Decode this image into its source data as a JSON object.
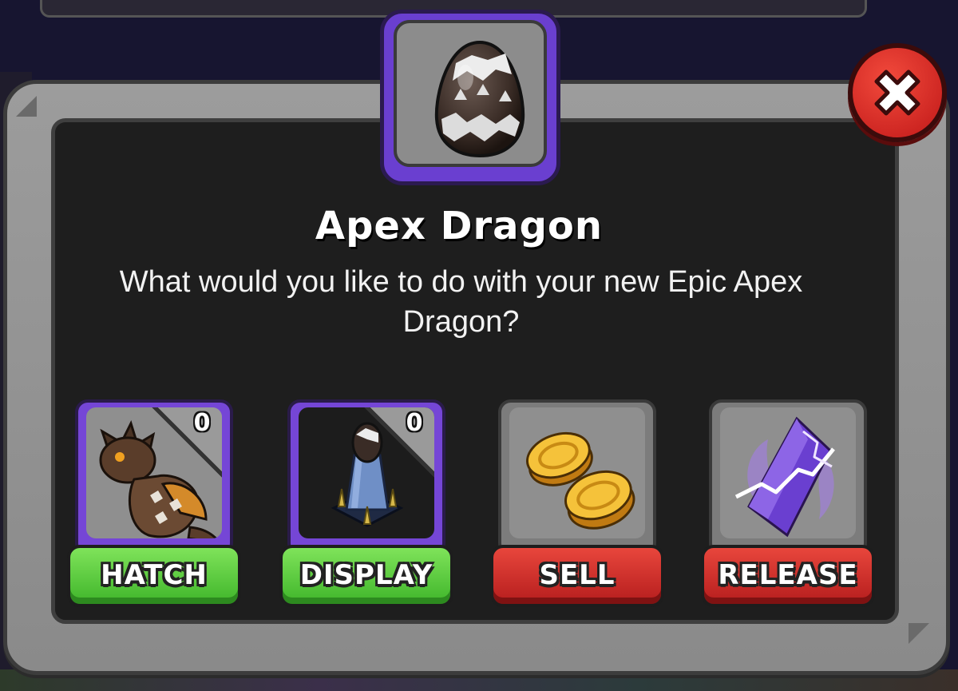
{
  "dialog": {
    "title": "Apex Dragon",
    "message": "What would you like to do with your new Epic Apex Dragon?",
    "egg_icon": "apex-dragon-egg-icon",
    "close_icon": "close-x-icon"
  },
  "options": [
    {
      "label": "HATCH",
      "count": "0",
      "icon": "apex-dragon-icon",
      "color": "#4cc234"
    },
    {
      "label": "DISPLAY",
      "count": "0",
      "icon": "egg-display-stand-icon",
      "color": "#4cc234"
    },
    {
      "label": "SELL",
      "icon": "gold-coins-icon",
      "color": "#d42a24"
    },
    {
      "label": "RELEASE",
      "icon": "purple-crystal-lightning-icon",
      "color": "#d42a24"
    }
  ],
  "colors": {
    "epic_purple": "#7546d6",
    "frame_grey": "#8f8f8f",
    "panel_dark": "#1e1e1e"
  }
}
